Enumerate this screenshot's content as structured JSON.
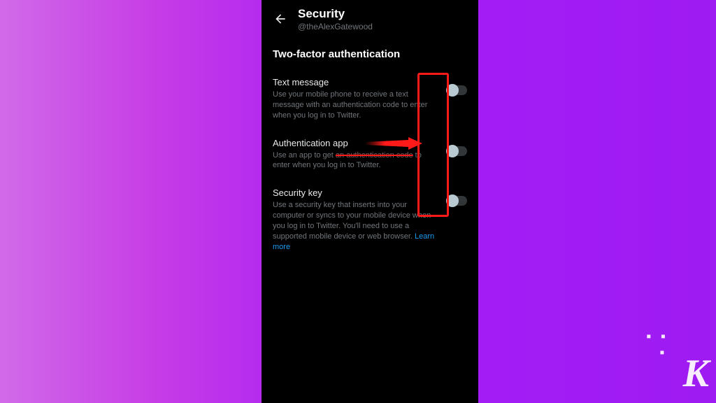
{
  "header": {
    "title": "Security",
    "handle": "@theAlexGatewood"
  },
  "section_title": "Two-factor authentication",
  "items": [
    {
      "title": "Text message",
      "desc": "Use your mobile phone to receive a text message with an authentication code to enter when you log in to Twitter."
    },
    {
      "title": "Authentication app",
      "desc_prefix": "Use an app to get ",
      "desc_struck": "an authentication code",
      "desc_suffix": " to enter when you log in to Twitter."
    },
    {
      "title": "Security key",
      "desc": "Use a security key that inserts into your computer or syncs to your mobile device when you log in to Twitter. You'll need to use a supported mobile device or web browser. ",
      "learn_more": "Learn more"
    }
  ],
  "watermark": "K"
}
